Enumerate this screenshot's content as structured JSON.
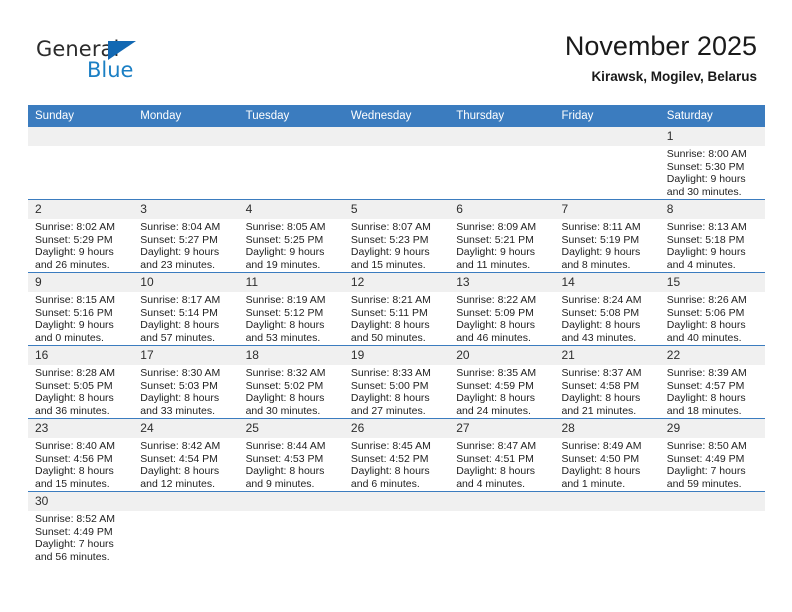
{
  "brand": {
    "name_top": "General",
    "name_bottom": "Blue",
    "triangle_color": "#1268b3",
    "blue_color": "#1b7fc4"
  },
  "header": {
    "title": "November 2025",
    "subtitle": "Kirawsk, Mogilev, Belarus",
    "accent_color": "#3b7cbf",
    "daynum_band_color": "#f0f0f0"
  },
  "weekday_headers": [
    "Sunday",
    "Monday",
    "Tuesday",
    "Wednesday",
    "Thursday",
    "Friday",
    "Saturday"
  ],
  "labels": {
    "sunrise_prefix": "Sunrise:",
    "sunset_prefix": "Sunset:",
    "daylight_prefix": "Daylight:"
  },
  "weeks": [
    [
      {
        "day": "",
        "sunrise": "",
        "sunset": "",
        "daylight_line1": "",
        "daylight_line2": ""
      },
      {
        "day": "",
        "sunrise": "",
        "sunset": "",
        "daylight_line1": "",
        "daylight_line2": ""
      },
      {
        "day": "",
        "sunrise": "",
        "sunset": "",
        "daylight_line1": "",
        "daylight_line2": ""
      },
      {
        "day": "",
        "sunrise": "",
        "sunset": "",
        "daylight_line1": "",
        "daylight_line2": ""
      },
      {
        "day": "",
        "sunrise": "",
        "sunset": "",
        "daylight_line1": "",
        "daylight_line2": ""
      },
      {
        "day": "",
        "sunrise": "",
        "sunset": "",
        "daylight_line1": "",
        "daylight_line2": ""
      },
      {
        "day": "1",
        "sunrise": "Sunrise: 8:00 AM",
        "sunset": "Sunset: 5:30 PM",
        "daylight_line1": "Daylight: 9 hours",
        "daylight_line2": "and 30 minutes."
      }
    ],
    [
      {
        "day": "2",
        "sunrise": "Sunrise: 8:02 AM",
        "sunset": "Sunset: 5:29 PM",
        "daylight_line1": "Daylight: 9 hours",
        "daylight_line2": "and 26 minutes."
      },
      {
        "day": "3",
        "sunrise": "Sunrise: 8:04 AM",
        "sunset": "Sunset: 5:27 PM",
        "daylight_line1": "Daylight: 9 hours",
        "daylight_line2": "and 23 minutes."
      },
      {
        "day": "4",
        "sunrise": "Sunrise: 8:05 AM",
        "sunset": "Sunset: 5:25 PM",
        "daylight_line1": "Daylight: 9 hours",
        "daylight_line2": "and 19 minutes."
      },
      {
        "day": "5",
        "sunrise": "Sunrise: 8:07 AM",
        "sunset": "Sunset: 5:23 PM",
        "daylight_line1": "Daylight: 9 hours",
        "daylight_line2": "and 15 minutes."
      },
      {
        "day": "6",
        "sunrise": "Sunrise: 8:09 AM",
        "sunset": "Sunset: 5:21 PM",
        "daylight_line1": "Daylight: 9 hours",
        "daylight_line2": "and 11 minutes."
      },
      {
        "day": "7",
        "sunrise": "Sunrise: 8:11 AM",
        "sunset": "Sunset: 5:19 PM",
        "daylight_line1": "Daylight: 9 hours",
        "daylight_line2": "and 8 minutes."
      },
      {
        "day": "8",
        "sunrise": "Sunrise: 8:13 AM",
        "sunset": "Sunset: 5:18 PM",
        "daylight_line1": "Daylight: 9 hours",
        "daylight_line2": "and 4 minutes."
      }
    ],
    [
      {
        "day": "9",
        "sunrise": "Sunrise: 8:15 AM",
        "sunset": "Sunset: 5:16 PM",
        "daylight_line1": "Daylight: 9 hours",
        "daylight_line2": "and 0 minutes."
      },
      {
        "day": "10",
        "sunrise": "Sunrise: 8:17 AM",
        "sunset": "Sunset: 5:14 PM",
        "daylight_line1": "Daylight: 8 hours",
        "daylight_line2": "and 57 minutes."
      },
      {
        "day": "11",
        "sunrise": "Sunrise: 8:19 AM",
        "sunset": "Sunset: 5:12 PM",
        "daylight_line1": "Daylight: 8 hours",
        "daylight_line2": "and 53 minutes."
      },
      {
        "day": "12",
        "sunrise": "Sunrise: 8:21 AM",
        "sunset": "Sunset: 5:11 PM",
        "daylight_line1": "Daylight: 8 hours",
        "daylight_line2": "and 50 minutes."
      },
      {
        "day": "13",
        "sunrise": "Sunrise: 8:22 AM",
        "sunset": "Sunset: 5:09 PM",
        "daylight_line1": "Daylight: 8 hours",
        "daylight_line2": "and 46 minutes."
      },
      {
        "day": "14",
        "sunrise": "Sunrise: 8:24 AM",
        "sunset": "Sunset: 5:08 PM",
        "daylight_line1": "Daylight: 8 hours",
        "daylight_line2": "and 43 minutes."
      },
      {
        "day": "15",
        "sunrise": "Sunrise: 8:26 AM",
        "sunset": "Sunset: 5:06 PM",
        "daylight_line1": "Daylight: 8 hours",
        "daylight_line2": "and 40 minutes."
      }
    ],
    [
      {
        "day": "16",
        "sunrise": "Sunrise: 8:28 AM",
        "sunset": "Sunset: 5:05 PM",
        "daylight_line1": "Daylight: 8 hours",
        "daylight_line2": "and 36 minutes."
      },
      {
        "day": "17",
        "sunrise": "Sunrise: 8:30 AM",
        "sunset": "Sunset: 5:03 PM",
        "daylight_line1": "Daylight: 8 hours",
        "daylight_line2": "and 33 minutes."
      },
      {
        "day": "18",
        "sunrise": "Sunrise: 8:32 AM",
        "sunset": "Sunset: 5:02 PM",
        "daylight_line1": "Daylight: 8 hours",
        "daylight_line2": "and 30 minutes."
      },
      {
        "day": "19",
        "sunrise": "Sunrise: 8:33 AM",
        "sunset": "Sunset: 5:00 PM",
        "daylight_line1": "Daylight: 8 hours",
        "daylight_line2": "and 27 minutes."
      },
      {
        "day": "20",
        "sunrise": "Sunrise: 8:35 AM",
        "sunset": "Sunset: 4:59 PM",
        "daylight_line1": "Daylight: 8 hours",
        "daylight_line2": "and 24 minutes."
      },
      {
        "day": "21",
        "sunrise": "Sunrise: 8:37 AM",
        "sunset": "Sunset: 4:58 PM",
        "daylight_line1": "Daylight: 8 hours",
        "daylight_line2": "and 21 minutes."
      },
      {
        "day": "22",
        "sunrise": "Sunrise: 8:39 AM",
        "sunset": "Sunset: 4:57 PM",
        "daylight_line1": "Daylight: 8 hours",
        "daylight_line2": "and 18 minutes."
      }
    ],
    [
      {
        "day": "23",
        "sunrise": "Sunrise: 8:40 AM",
        "sunset": "Sunset: 4:56 PM",
        "daylight_line1": "Daylight: 8 hours",
        "daylight_line2": "and 15 minutes."
      },
      {
        "day": "24",
        "sunrise": "Sunrise: 8:42 AM",
        "sunset": "Sunset: 4:54 PM",
        "daylight_line1": "Daylight: 8 hours",
        "daylight_line2": "and 12 minutes."
      },
      {
        "day": "25",
        "sunrise": "Sunrise: 8:44 AM",
        "sunset": "Sunset: 4:53 PM",
        "daylight_line1": "Daylight: 8 hours",
        "daylight_line2": "and 9 minutes."
      },
      {
        "day": "26",
        "sunrise": "Sunrise: 8:45 AM",
        "sunset": "Sunset: 4:52 PM",
        "daylight_line1": "Daylight: 8 hours",
        "daylight_line2": "and 6 minutes."
      },
      {
        "day": "27",
        "sunrise": "Sunrise: 8:47 AM",
        "sunset": "Sunset: 4:51 PM",
        "daylight_line1": "Daylight: 8 hours",
        "daylight_line2": "and 4 minutes."
      },
      {
        "day": "28",
        "sunrise": "Sunrise: 8:49 AM",
        "sunset": "Sunset: 4:50 PM",
        "daylight_line1": "Daylight: 8 hours",
        "daylight_line2": "and 1 minute."
      },
      {
        "day": "29",
        "sunrise": "Sunrise: 8:50 AM",
        "sunset": "Sunset: 4:49 PM",
        "daylight_line1": "Daylight: 7 hours",
        "daylight_line2": "and 59 minutes."
      }
    ],
    [
      {
        "day": "30",
        "sunrise": "Sunrise: 8:52 AM",
        "sunset": "Sunset: 4:49 PM",
        "daylight_line1": "Daylight: 7 hours",
        "daylight_line2": "and 56 minutes."
      },
      {
        "day": "",
        "sunrise": "",
        "sunset": "",
        "daylight_line1": "",
        "daylight_line2": ""
      },
      {
        "day": "",
        "sunrise": "",
        "sunset": "",
        "daylight_line1": "",
        "daylight_line2": ""
      },
      {
        "day": "",
        "sunrise": "",
        "sunset": "",
        "daylight_line1": "",
        "daylight_line2": ""
      },
      {
        "day": "",
        "sunrise": "",
        "sunset": "",
        "daylight_line1": "",
        "daylight_line2": ""
      },
      {
        "day": "",
        "sunrise": "",
        "sunset": "",
        "daylight_line1": "",
        "daylight_line2": ""
      },
      {
        "day": "",
        "sunrise": "",
        "sunset": "",
        "daylight_line1": "",
        "daylight_line2": ""
      }
    ]
  ]
}
